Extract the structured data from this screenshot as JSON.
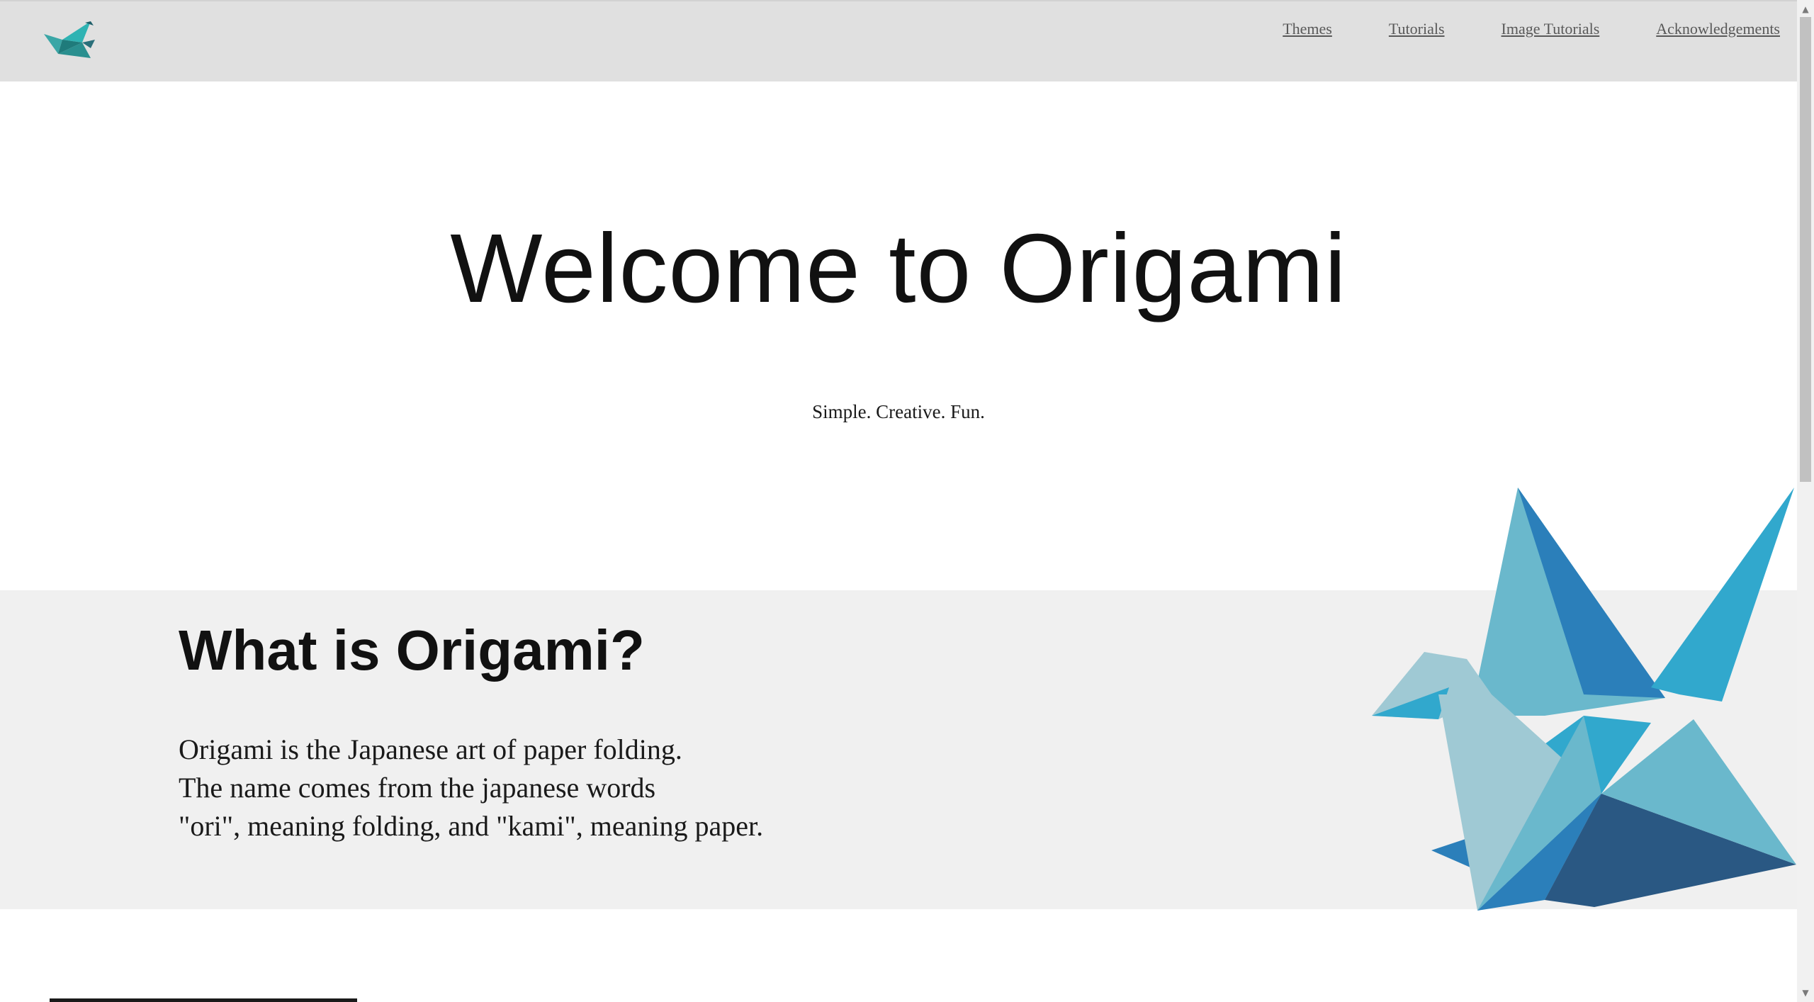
{
  "header": {
    "nav": [
      {
        "label": "Themes"
      },
      {
        "label": "Tutorials"
      },
      {
        "label": "Image Tutorials"
      },
      {
        "label": "Acknowledgements"
      }
    ],
    "logo_icon": "origami-bird-icon"
  },
  "hero": {
    "title": "Welcome to Origami",
    "subtitle": "Simple. Creative. Fun."
  },
  "about": {
    "title": "What is Origami?",
    "lines": [
      "Origami is the Japanese art of paper folding.",
      "The name comes from the japanese words",
      "\"ori\", meaning folding, and \"kami\", meaning paper."
    ],
    "image_icon": "origami-crane-icon"
  },
  "colors": {
    "header_bg": "#e0e0e0",
    "section_bg": "#f0f0f0",
    "crane_light": "#9fc9d4",
    "crane_mid": "#6ab8cc",
    "crane_cyan": "#31a8cd",
    "crane_blue": "#2b7fba",
    "crane_dark": "#2a5883"
  }
}
